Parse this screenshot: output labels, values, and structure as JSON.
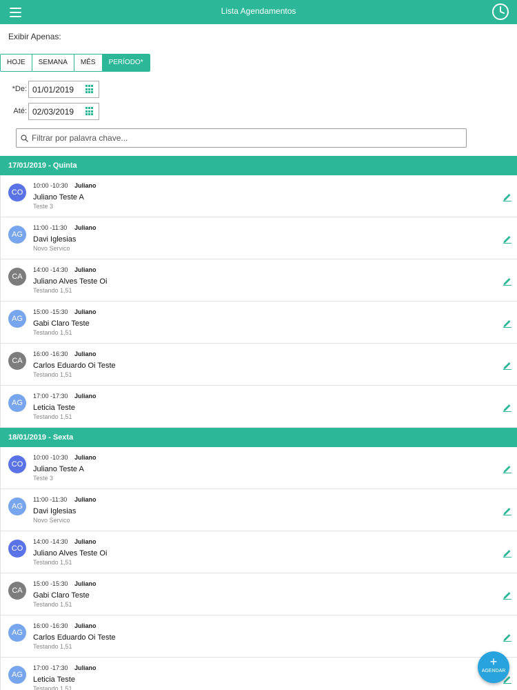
{
  "header": {
    "title": "Lista Agendamentos",
    "menu_icon": "hamburger-menu-icon",
    "clock_icon": "clock-icon"
  },
  "filter": {
    "show_only_label": "Exibir Apenas:",
    "periods": [
      {
        "label": "HOJE",
        "active": false
      },
      {
        "label": "SEMANA",
        "active": false
      },
      {
        "label": "MÊS",
        "active": false
      },
      {
        "label": "PERÍODO*",
        "active": true
      }
    ],
    "from_label": "*De:",
    "from_value": "01/01/2019",
    "to_label": "Até:",
    "to_value": "02/03/2019",
    "search_placeholder": "Filtrar por palavra chave..."
  },
  "days": [
    {
      "header": "17/01/2019 - Quinta",
      "appointments": [
        {
          "initials": "CO",
          "color": "#5b73e8",
          "time": "10:00 -10:30",
          "professional": "Juliano",
          "client": "Juliano Teste A",
          "service": "Teste 3"
        },
        {
          "initials": "AG",
          "color": "#78a6ee",
          "time": "11:00 -11:30",
          "professional": "Juliano",
          "client": "Davi Iglesias",
          "service": "Novo Servico"
        },
        {
          "initials": "CA",
          "color": "#7d7d7d",
          "time": "14:00 -14:30",
          "professional": "Juliano",
          "client": "Juliano Alves Teste Oi",
          "service": "Testando 1,51"
        },
        {
          "initials": "AG",
          "color": "#78a6ee",
          "time": "15:00 -15:30",
          "professional": "Juliano",
          "client": "Gabi Claro Teste",
          "service": "Testando 1,51"
        },
        {
          "initials": "CA",
          "color": "#7d7d7d",
          "time": "16:00 -16:30",
          "professional": "Juliano",
          "client": "Carlos Eduardo Oi Teste",
          "service": "Testando 1,51"
        },
        {
          "initials": "AG",
          "color": "#78a6ee",
          "time": "17:00 -17:30",
          "professional": "Juliano",
          "client": "Leticia Teste",
          "service": "Testando 1,51"
        }
      ]
    },
    {
      "header": "18/01/2019 - Sexta",
      "appointments": [
        {
          "initials": "CO",
          "color": "#5b73e8",
          "time": "10:00 -10:30",
          "professional": "Juliano",
          "client": "Juliano Teste A",
          "service": "Teste 3"
        },
        {
          "initials": "AG",
          "color": "#78a6ee",
          "time": "11:00 -11:30",
          "professional": "Juliano",
          "client": "Davi Iglesias",
          "service": "Novo Servico"
        },
        {
          "initials": "CO",
          "color": "#5b73e8",
          "time": "14:00 -14:30",
          "professional": "Juliano",
          "client": "Juliano Alves Teste Oi",
          "service": "Testando 1,51"
        },
        {
          "initials": "CA",
          "color": "#7d7d7d",
          "time": "15:00 -15:30",
          "professional": "Juliano",
          "client": "Gabi Claro Teste",
          "service": "Testando 1,51"
        },
        {
          "initials": "AG",
          "color": "#78a6ee",
          "time": "16:00 -16:30",
          "professional": "Juliano",
          "client": "Carlos Eduardo Oi Teste",
          "service": "Testando 1,51"
        },
        {
          "initials": "AG",
          "color": "#78a6ee",
          "time": "17:00 -17:30",
          "professional": "Juliano",
          "client": "Leticia Teste",
          "service": "Testando 1,51"
        }
      ]
    }
  ],
  "fab": {
    "label": "AGENDAR",
    "icon": "plus-icon"
  },
  "colors": {
    "primary": "#2db799",
    "fab": "#29a3dd"
  }
}
